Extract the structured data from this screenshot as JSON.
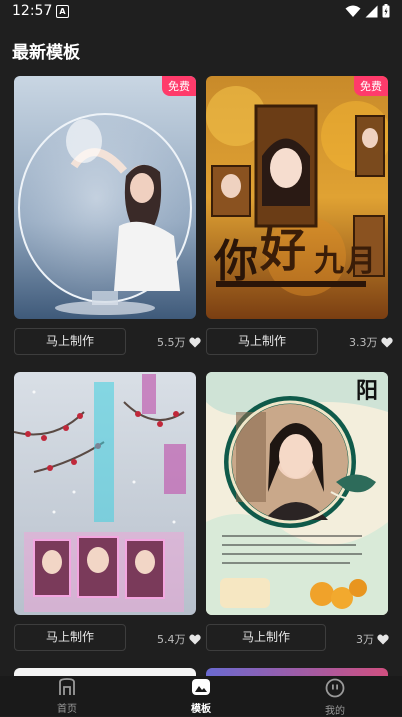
{
  "status": {
    "time": "12:57"
  },
  "page": {
    "title": "最新模板"
  },
  "templates": [
    {
      "badge": "免费",
      "button": "马上制作",
      "likes": "5.5万"
    },
    {
      "badge": "免费",
      "button": "马上制作",
      "likes": "3.3万"
    },
    {
      "badge": "",
      "button": "马上制作",
      "likes": "5.4万"
    },
    {
      "badge": "",
      "button": "马上制作",
      "likes": "3万",
      "overlay_char": "阳"
    }
  ],
  "nav": {
    "items": [
      {
        "label": "首页",
        "icon": "home-icon"
      },
      {
        "label": "模板",
        "icon": "template-icon",
        "active": true
      },
      {
        "label": "我的",
        "icon": "profile-icon"
      }
    ]
  },
  "colors": {
    "background": "#1f1f1f",
    "badge": "#ff3b6b"
  }
}
